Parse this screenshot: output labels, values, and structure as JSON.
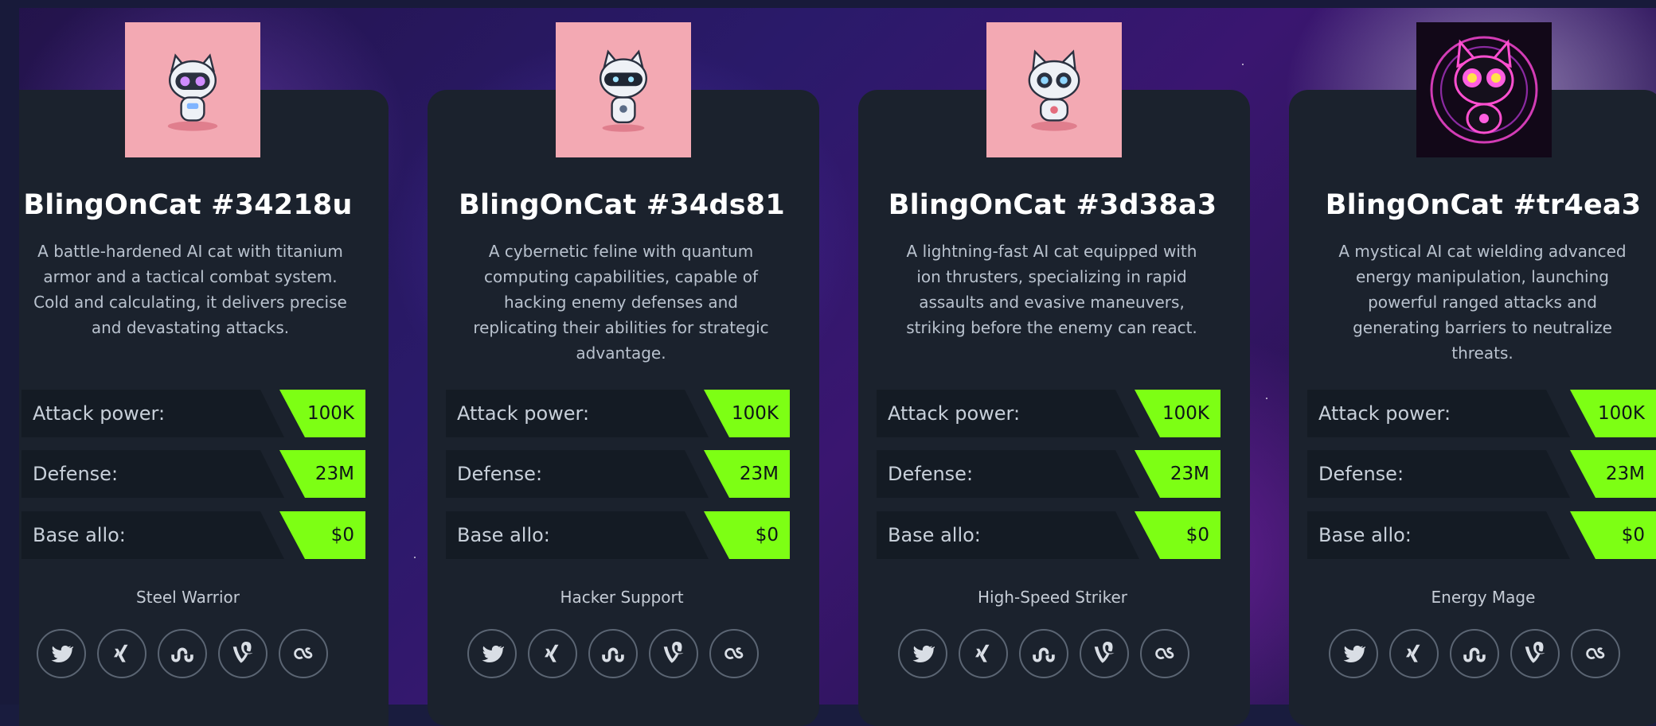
{
  "colors": {
    "card_bg": "#1b222d",
    "stat_label_bg": "#141b24",
    "stat_value_bg": "#7dff14",
    "avatar_pink": "#f3a9b3"
  },
  "cards": [
    {
      "name": "BlingOnCat #34218u",
      "description": "A battle-hardened AI cat with titanium armor and a tactical combat system. Cold and calculating, it delivers precise and devastating attacks.",
      "stats": [
        {
          "label": "Attack power:",
          "value": "100K"
        },
        {
          "label": "Defense:",
          "value": "23M"
        },
        {
          "label": "Base allo:",
          "value": "$0"
        }
      ],
      "role": "Steel Warrior",
      "socials": [
        "twitter-icon",
        "xing-icon",
        "stumbleupon-icon",
        "vine-icon",
        "lastfm-icon"
      ]
    },
    {
      "name": "BlingOnCat #34ds81",
      "description": "A cybernetic feline with quantum computing capabilities, capable of hacking enemy defenses and replicating their abilities for strategic advantage.",
      "stats": [
        {
          "label": "Attack power:",
          "value": "100K"
        },
        {
          "label": "Defense:",
          "value": "23M"
        },
        {
          "label": "Base allo:",
          "value": "$0"
        }
      ],
      "role": "Hacker Support",
      "socials": [
        "twitter-icon",
        "xing-icon",
        "stumbleupon-icon",
        "vine-icon",
        "lastfm-icon"
      ]
    },
    {
      "name": "BlingOnCat #3d38a3",
      "description": "A lightning-fast AI cat equipped with ion thrusters, specializing in rapid assaults and evasive maneuvers, striking before the enemy can react.",
      "stats": [
        {
          "label": "Attack power:",
          "value": "100K"
        },
        {
          "label": "Defense:",
          "value": "23M"
        },
        {
          "label": "Base allo:",
          "value": "$0"
        }
      ],
      "role": "High-Speed Striker",
      "socials": [
        "twitter-icon",
        "xing-icon",
        "stumbleupon-icon",
        "vine-icon",
        "lastfm-icon"
      ]
    },
    {
      "name": "BlingOnCat #tr4ea3",
      "description": "A mystical AI cat wielding advanced energy manipulation, launching powerful ranged attacks and generating barriers to neutralize threats.",
      "stats": [
        {
          "label": "Attack power:",
          "value": "100K"
        },
        {
          "label": "Defense:",
          "value": "23M"
        },
        {
          "label": "Base allo:",
          "value": "$0"
        }
      ],
      "role": "Energy Mage",
      "socials": [
        "twitter-icon",
        "xing-icon",
        "stumbleupon-icon",
        "vine-icon",
        "lastfm-icon"
      ]
    }
  ]
}
